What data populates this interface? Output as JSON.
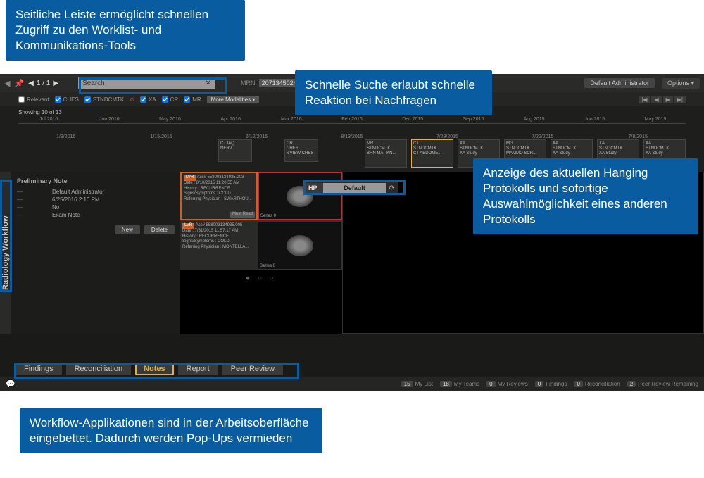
{
  "callouts": {
    "c1": "Seitliche Leiste ermöglicht schnellen Zugriff zu den Worklist- und Kommunikations-Tools",
    "c2": "Schnelle Suche erlaubt schnelle Reaktion bei Nachfragen",
    "c3": "Anzeige des aktuellen Hanging Protokolls und sofortige Auswahlmöglichkeit eines anderen Protokolls",
    "c4": "Workflow-Applikationen sind in der Arbeitsoberfläche eingebettet. Dadurch werden Pop-Ups vermieden"
  },
  "topbar": {
    "counter": "1 / 1",
    "search_placeholder": "Search",
    "mrn_label": "MRN:",
    "mrn_value": "20713450247",
    "user": "Default Administrator",
    "options": "Options ▾"
  },
  "filters": {
    "relevant": "Relevant",
    "ches": "CHES",
    "stndcmtk": "STNDCMTK",
    "xa": "XA",
    "cr": "CR",
    "mr": "MR",
    "more": "More Modalities ▾"
  },
  "timeline": {
    "showing": "Showing 10 of 13",
    "months": [
      "Jul 2016",
      "Jun 2016",
      "May 2016",
      "Apr 2016",
      "Mar 2016",
      "Feb 2016",
      "Dec 2015",
      "Sep 2015",
      "Aug 2015",
      "Jun 2015",
      "May 2015"
    ],
    "dates": [
      "1/9/2016",
      "1/15/2016",
      "",
      "6/12/2015",
      "",
      "8/13/2015",
      "",
      "7/29/2015",
      "",
      "7/22/2015",
      "",
      "7/8/2015"
    ]
  },
  "study_boxes": {
    "b1a": "CT IAQ NERV...",
    "b1b": "CR\nCHES\nx VIEW CHEST",
    "s": [
      {
        "mod": "MR",
        "desc": "STNDCMTK",
        "extra": "BRN MAT KN..."
      },
      {
        "mod": "CT",
        "desc": "STNDCMTK",
        "extra": "CT ABDOME..."
      },
      {
        "mod": "XA",
        "desc": "STNDCMTK",
        "extra": "XA Study"
      },
      {
        "mod": "MG",
        "desc": "STNDCMTK",
        "extra": "MAMMO SCR..."
      },
      {
        "mod": "XA",
        "desc": "STNDCMTK",
        "extra": "XA Study"
      },
      {
        "mod": "XA",
        "desc": "STNDCMTK",
        "extra": "XA Study"
      },
      {
        "mod": "XA",
        "desc": "STNDCMTK",
        "extra": "XA Study"
      }
    ]
  },
  "side_tab": "Radiology Workflow",
  "note": {
    "title": "Preliminary Note",
    "admin": "Default Administrator",
    "date": "6/25/2016 2:10 PM",
    "no": "No",
    "exam_note": "Exam Note",
    "new_btn": "New",
    "delete_btn": "Delete"
  },
  "series": {
    "card1": {
      "tag": "LVR",
      "acc": "Acc# 558003134935.003",
      "date": "Date : 8/10/2015 11:20:55 AM",
      "history": "History : RECURRENCE",
      "signs": "Signs/Symptoms : COLD",
      "ref": "Referring Physician : SWARTHOU...",
      "must_read": "Must Read",
      "label": "Series 0"
    },
    "card2": {
      "tag": "LVR",
      "acc": "Acc# 558003134935.005",
      "date": "Date : 7/31/2015 11:57:17 AM",
      "history": "History : RECURRENCE",
      "signs": "Signs/Symptoms : COLD",
      "ref": "Referring Physician : MONTELLA...",
      "label": "Series 0"
    }
  },
  "hp": {
    "label": "HP",
    "value": "Default"
  },
  "workflow_tabs": {
    "findings": "Findings",
    "reconciliation": "Reconciliation",
    "notes": "Notes",
    "report": "Report",
    "peer_review": "Peer Review"
  },
  "bottom": {
    "mylist_n": "15",
    "mylist": "My List",
    "myteams_n": "18",
    "myteams": "My Teams",
    "reviews_n": "0",
    "reviews": "My Reviews",
    "findings_n": "0",
    "findings": "Findings",
    "recon_n": "0",
    "recon": "Reconciliation",
    "peer_n": "2",
    "peer": "Peer Review Remaining"
  }
}
